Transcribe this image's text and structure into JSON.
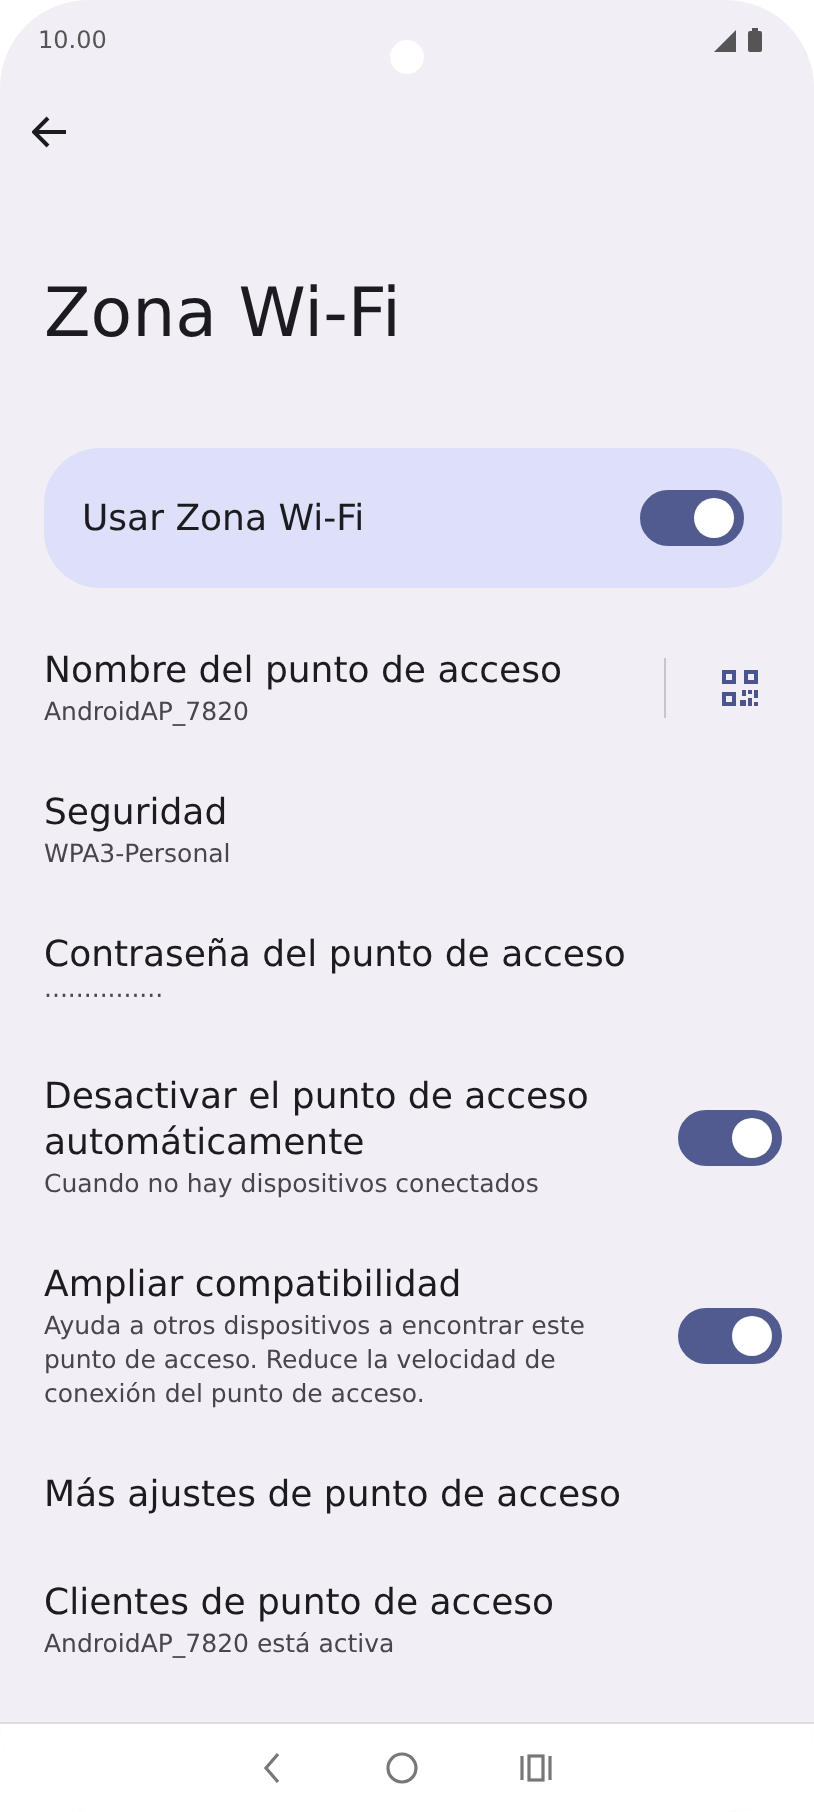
{
  "status_bar": {
    "time": "10.00"
  },
  "title": "Zona Wi-Fi",
  "main_switch": {
    "label": "Usar Zona Wi-Fi",
    "on": true
  },
  "settings": [
    {
      "kind": "qr",
      "title": "Nombre del punto de acceso",
      "subtitle": "AndroidAP_7820"
    },
    {
      "kind": "item",
      "title": "Seguridad",
      "subtitle": "WPA3-Personal"
    },
    {
      "kind": "item",
      "title": "Contraseña del punto de acceso",
      "subtitle": "···············"
    },
    {
      "kind": "switch",
      "title": "Desactivar el punto de acceso automáticamente",
      "subtitle": "Cuando no hay dispositivos conectados",
      "on": true
    },
    {
      "kind": "switch",
      "title": "Ampliar compatibilidad",
      "subtitle": "Ayuda a otros dispositivos a encontrar este punto de acceso. Reduce la velocidad de conexión del punto de acceso.",
      "on": true
    },
    {
      "kind": "item",
      "title": "Más ajustes de punto de acceso"
    },
    {
      "kind": "item",
      "title": "Clientes de punto de acceso",
      "subtitle": "AndroidAP_7820 está activa"
    }
  ]
}
